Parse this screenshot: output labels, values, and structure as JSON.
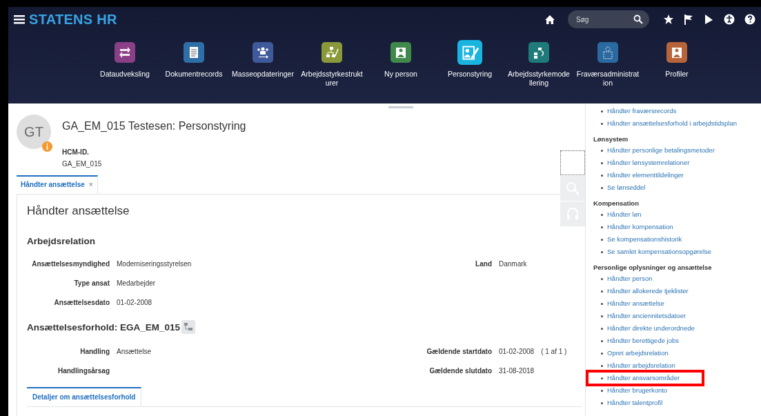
{
  "header": {
    "title": "STATENS HR",
    "search": {
      "placeholder": "Søg"
    }
  },
  "apps": [
    {
      "label": "Dataudveksling",
      "color": "#8a3f86",
      "selected": false
    },
    {
      "label": "Dokumentrecords",
      "color": "#2f6fa8",
      "selected": false
    },
    {
      "label": "Masseopdateringer",
      "color": "#3f5a9a",
      "selected": false
    },
    {
      "label": "Arbejdsstyrkestrukt\nurer",
      "color": "#8a9a3a",
      "selected": false
    },
    {
      "label": "Ny person",
      "color": "#3f8a4a",
      "selected": false
    },
    {
      "label": "Personstyring",
      "color": "#19b5e0",
      "selected": true
    },
    {
      "label": "Arbejdsstyrkemode\nllering",
      "color": "#1f7a7a",
      "selected": false
    },
    {
      "label": "Fraværsadministrat\nion",
      "color": "#2a6aa0",
      "selected": false
    },
    {
      "label": "Profiler",
      "color": "#b8643a",
      "selected": false
    }
  ],
  "person": {
    "avatar": "GT",
    "title": "GA_EM_015 Testesen: Personstyring",
    "id_label": "HCM-ID.",
    "id_value": "GA_EM_015"
  },
  "tabs": [
    {
      "label": "Håndter ansættelse",
      "close": "×",
      "selected": true
    }
  ],
  "page_title": "Håndter ansættelse",
  "sections": [
    {
      "title": "Arbejdsrelation",
      "rows": [
        {
          "label": "Ansættelsesmyndighed",
          "value": "Moderniseringsstyrelsen",
          "right_label": "Land",
          "right_value": "Danmark"
        },
        {
          "label": "Type ansat",
          "value": "Medarbejder"
        },
        {
          "label": "Ansættelsesdato",
          "value": "01-02-2008"
        }
      ]
    },
    {
      "title": "Ansættelsesforhold: EGA_EM_015",
      "rows": [
        {
          "label": "Handling",
          "value": "Ansættelse",
          "right_label": "Gældende startdato",
          "right_value": "01-02-2008",
          "right_extra": "( 1 af 1 )"
        },
        {
          "label": "Handlingsårsag",
          "right_label": "Gældende slutdato",
          "right_value": "31-08-2018"
        }
      ]
    }
  ],
  "subtabs": [
    {
      "label": "Detaljer om ansættelsesforhold",
      "selected": true
    }
  ],
  "tasks": [
    {
      "items": [
        {
          "label": "Håndter fraværsrecords",
          "highlighted": false
        },
        {
          "label": "Håndter ansættelsesforhold i arbejdstidsplan",
          "highlighted": false
        }
      ]
    },
    {
      "heading": "Lønsystem",
      "items": [
        {
          "label": "Håndter personlige betalingsmetoder",
          "highlighted": false
        },
        {
          "label": "Håndter lønsystemrelationer",
          "highlighted": false
        },
        {
          "label": "Håndter elementtildelinger",
          "highlighted": false
        },
        {
          "label": "Se lønseddel",
          "highlighted": false
        }
      ]
    },
    {
      "heading": "Kompensation",
      "items": [
        {
          "label": "Håndter løn",
          "highlighted": false
        },
        {
          "label": "Håndter kompensation",
          "highlighted": false
        },
        {
          "label": "Se kompensationshistorik",
          "highlighted": false
        },
        {
          "label": "Se samlet kompensationsopgørelse",
          "highlighted": false
        }
      ]
    },
    {
      "heading": "Personlige oplysninger og ansættelse",
      "items": [
        {
          "label": "Håndter person",
          "highlighted": false
        },
        {
          "label": "Håndter allokerede tjeklister",
          "highlighted": false
        },
        {
          "label": "Håndter ansættelse",
          "highlighted": false
        },
        {
          "label": "Håndter anciennitetsdatoer",
          "highlighted": false
        },
        {
          "label": "Håndter direkte underordnede",
          "highlighted": false
        },
        {
          "label": "Håndter berettigede jobs",
          "highlighted": false
        },
        {
          "label": "Opret arbejdsrelation",
          "highlighted": false
        },
        {
          "label": "Håndter arbejdsrelation",
          "highlighted": false
        },
        {
          "label": "Håndter ansvarsområder",
          "highlighted": true
        },
        {
          "label": "Håndter brugerkonto",
          "highlighted": false
        },
        {
          "label": "Håndter talentprofil",
          "highlighted": false
        }
      ]
    }
  ]
}
